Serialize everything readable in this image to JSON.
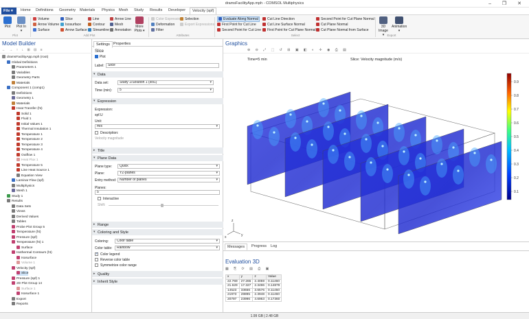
{
  "window": {
    "title": "dramsFacilityApp.mph - COMSOL Multiphysics",
    "controls": "–  ❐  ✕"
  },
  "tabs": {
    "file": "File ▾",
    "items": [
      "Home",
      "Definitions",
      "Geometry",
      "Materials",
      "Physics",
      "Mesh",
      "Study",
      "Results",
      "Developer",
      "Velocity (spf)"
    ]
  },
  "ribbon": {
    "plot": "Plot",
    "plot_in": "Plot In ▾",
    "col1": [
      "Volume",
      "Arrow Volume",
      "Surface"
    ],
    "col2": [
      "Slice",
      "Isosurface",
      "Arrow Surface"
    ],
    "col3": [
      "Line",
      "Contour",
      "Streamline"
    ],
    "col4": [
      "Arrow Line",
      "Mesh",
      "Annotation"
    ],
    "more_plots": "More Plots ▾",
    "attrs": [
      "Color Expression",
      "Deformation",
      "Filter"
    ],
    "attrs2": [
      "Selection",
      "Export Expressions"
    ],
    "select_col1": [
      "Evaluate Along Normal",
      "First Point for Cut Line",
      "Second Point for Cut Line"
    ],
    "select_col2": [
      "Cut Line Direction",
      "Cut Line Surface Normal",
      "First Point for Cut Plane Normal"
    ],
    "select_col3": [
      "Second Point for Cut Plane Normal",
      "Cut Plane Normal",
      "Cut Plane Normal from Surface"
    ],
    "image": "3D Image ▾",
    "animation": "Animation ▾",
    "groups": [
      "Plot",
      "Add Plot",
      "Attributes",
      "Select",
      "Export"
    ]
  },
  "model_builder": {
    "title": "Model Builder",
    "tree": [
      {
        "label": "dramsFacilityApp.mph (root)",
        "depth": 0,
        "icon": "#888"
      },
      {
        "label": "Global Definitions",
        "depth": 1,
        "icon": "#3a6fc4"
      },
      {
        "label": "Parameters 1",
        "depth": 2,
        "icon": "#7a7a7a"
      },
      {
        "label": "Variables",
        "depth": 2,
        "icon": "#7a7a7a"
      },
      {
        "label": "Geometry Parts",
        "depth": 2,
        "icon": "#7a7a7a"
      },
      {
        "label": "Materials",
        "depth": 2,
        "icon": "#c0803a"
      },
      {
        "label": "Component 1 (comp1)",
        "depth": 1,
        "icon": "#3a6fc4"
      },
      {
        "label": "Definitions",
        "depth": 2,
        "icon": "#7a7a7a"
      },
      {
        "label": "Geometry 1",
        "depth": 2,
        "icon": "#6a6a9a"
      },
      {
        "label": "Materials",
        "depth": 2,
        "icon": "#c0803a"
      },
      {
        "label": "Heat Transfer (ht)",
        "depth": 2,
        "icon": "#c0392b"
      },
      {
        "label": "Solid 1",
        "depth": 3,
        "icon": "#c0392b"
      },
      {
        "label": "Fluid 1",
        "depth": 3,
        "icon": "#c0392b"
      },
      {
        "label": "Initial Values 1",
        "depth": 3,
        "icon": "#c0392b"
      },
      {
        "label": "Thermal Insulation 1",
        "depth": 3,
        "icon": "#c0392b"
      },
      {
        "label": "Temperature 1",
        "depth": 3,
        "icon": "#c0392b"
      },
      {
        "label": "Temperature 2",
        "depth": 3,
        "icon": "#c0392b"
      },
      {
        "label": "Temperature 3",
        "depth": 3,
        "icon": "#c0392b"
      },
      {
        "label": "Temperature 4",
        "depth": 3,
        "icon": "#c0392b"
      },
      {
        "label": "Outflow 1",
        "depth": 3,
        "icon": "#c0392b"
      },
      {
        "label": "Heat Flux 1",
        "depth": 3,
        "icon": "#d99",
        "gray": true
      },
      {
        "label": "Temperature 5",
        "depth": 3,
        "icon": "#c0392b"
      },
      {
        "label": "Line Heat Source 1",
        "depth": 3,
        "icon": "#c0392b"
      },
      {
        "label": "Equation View",
        "depth": 3,
        "icon": "#7a7a7a"
      },
      {
        "label": "Laminar Flow (spf)",
        "depth": 2,
        "icon": "#3a6fc4"
      },
      {
        "label": "Multiphysics",
        "depth": 2,
        "icon": "#7a7a7a"
      },
      {
        "label": "Mesh 1",
        "depth": 2,
        "icon": "#6a6a9a"
      },
      {
        "label": "Study 1",
        "depth": 1,
        "icon": "#3a9a4a"
      },
      {
        "label": "Results",
        "depth": 1,
        "icon": "#7a7a7a"
      },
      {
        "label": "Data Sets",
        "depth": 2,
        "icon": "#7a7a7a"
      },
      {
        "label": "Views",
        "depth": 2,
        "icon": "#7a7a7a"
      },
      {
        "label": "Derived Values",
        "depth": 2,
        "icon": "#7a7a7a"
      },
      {
        "label": "Tables",
        "depth": 2,
        "icon": "#7a7a7a"
      },
      {
        "label": "Probe Plot Group 5",
        "depth": 2,
        "icon": "#c04070"
      },
      {
        "label": "Temperature (ht)",
        "depth": 2,
        "icon": "#c04070"
      },
      {
        "label": "Pressure (spf)",
        "depth": 2,
        "icon": "#c04070"
      },
      {
        "label": "Temperature (ht) 1",
        "depth": 2,
        "icon": "#c04070"
      },
      {
        "label": "Surface",
        "depth": 3,
        "icon": "#c04070"
      },
      {
        "label": "Isothermal Contours (ht)",
        "depth": 2,
        "icon": "#c04070"
      },
      {
        "label": "Isosurface",
        "depth": 3,
        "icon": "#c04070"
      },
      {
        "label": "Volume 1",
        "depth": 3,
        "icon": "#d99",
        "gray": true
      },
      {
        "label": "Velocity (spf)",
        "depth": 2,
        "icon": "#c04070"
      },
      {
        "label": "Slice",
        "depth": 3,
        "icon": "#c04070",
        "selected": true
      },
      {
        "label": "Pressure (spf) 1",
        "depth": 2,
        "icon": "#c04070"
      },
      {
        "label": "2D Plot Group 14",
        "depth": 2,
        "icon": "#c04070"
      },
      {
        "label": "Surface 1",
        "depth": 3,
        "icon": "#d99",
        "gray": true
      },
      {
        "label": "Isosurface 1",
        "depth": 3,
        "icon": "#c04070"
      },
      {
        "label": "Export",
        "depth": 2,
        "icon": "#7a7a7a"
      },
      {
        "label": "Reports",
        "depth": 2,
        "icon": "#7a7a7a"
      }
    ]
  },
  "settings": {
    "tab_settings": "Settings",
    "tab_properties": "Properties",
    "node": "Slice",
    "plot_btn": "Plot",
    "label_label": "Label:",
    "label_value": "Slice",
    "sections": {
      "data": "Data",
      "expression": "Expression",
      "title": "Title",
      "plane_data": "Plane Data",
      "range": "Range",
      "coloring": "Coloring and Style",
      "quality": "Quality",
      "inherit": "Inherit Style"
    },
    "dataset_label": "Data set:",
    "dataset_value": "Study 1/Solution 1 (sol1)",
    "time_label": "Time (min):",
    "time_value": "5",
    "expr_label": "Expression:",
    "expr_value": "spf.U",
    "unit_label": "Unit:",
    "unit_value": "m/s",
    "desc_label": "Description:",
    "desc_value": "Velocity magnitude",
    "plane_type_label": "Plane type:",
    "plane_type_value": "Quick",
    "plane_label": "Plane:",
    "plane_value": "YZ-planes",
    "entry_label": "Entry method:",
    "entry_value": "Number of planes",
    "planes_label": "Planes:",
    "planes_value": "5",
    "interactive": "Interactive",
    "shift": "Shift:",
    "coloring_label": "Coloring:",
    "coloring_value": "Color table",
    "colortable_label": "Color table:",
    "colortable_value": "Rainbow",
    "color_legend": "Color legend",
    "reverse": "Reverse color table",
    "symmetrize": "Symmetrize color range"
  },
  "graphics": {
    "title": "Graphics",
    "time_text": "Time=5 min",
    "plot_title": "Slice: Velocity magnitude (m/s)",
    "colorbar_ticks": [
      "0.9",
      "0.8",
      "0.7",
      "0.6",
      "0.5",
      "0.4",
      "0.3",
      "0.2",
      "0.1"
    ],
    "axes": [
      "z",
      "y",
      "x"
    ]
  },
  "bottom": {
    "tabs": [
      "Messages",
      "Progress",
      "Log"
    ],
    "eval_title": "Evaluation 3D",
    "columns": [
      "x",
      "y",
      "z",
      "Value"
    ],
    "rows": [
      [
        "22.769",
        "27.265",
        "2.4059",
        "0.11460"
      ],
      [
        "21.629",
        "17.327",
        "2.3496",
        "0.14879"
      ],
      [
        "14523",
        "33656",
        "3.6576",
        "0.11450"
      ],
      [
        "21973",
        "28895",
        "2.3948",
        "0.11460"
      ],
      [
        "20797",
        "23996",
        "4.6963",
        "0.17360"
      ]
    ]
  },
  "status": {
    "memory": "1.99 GB | 2.48 GB"
  }
}
